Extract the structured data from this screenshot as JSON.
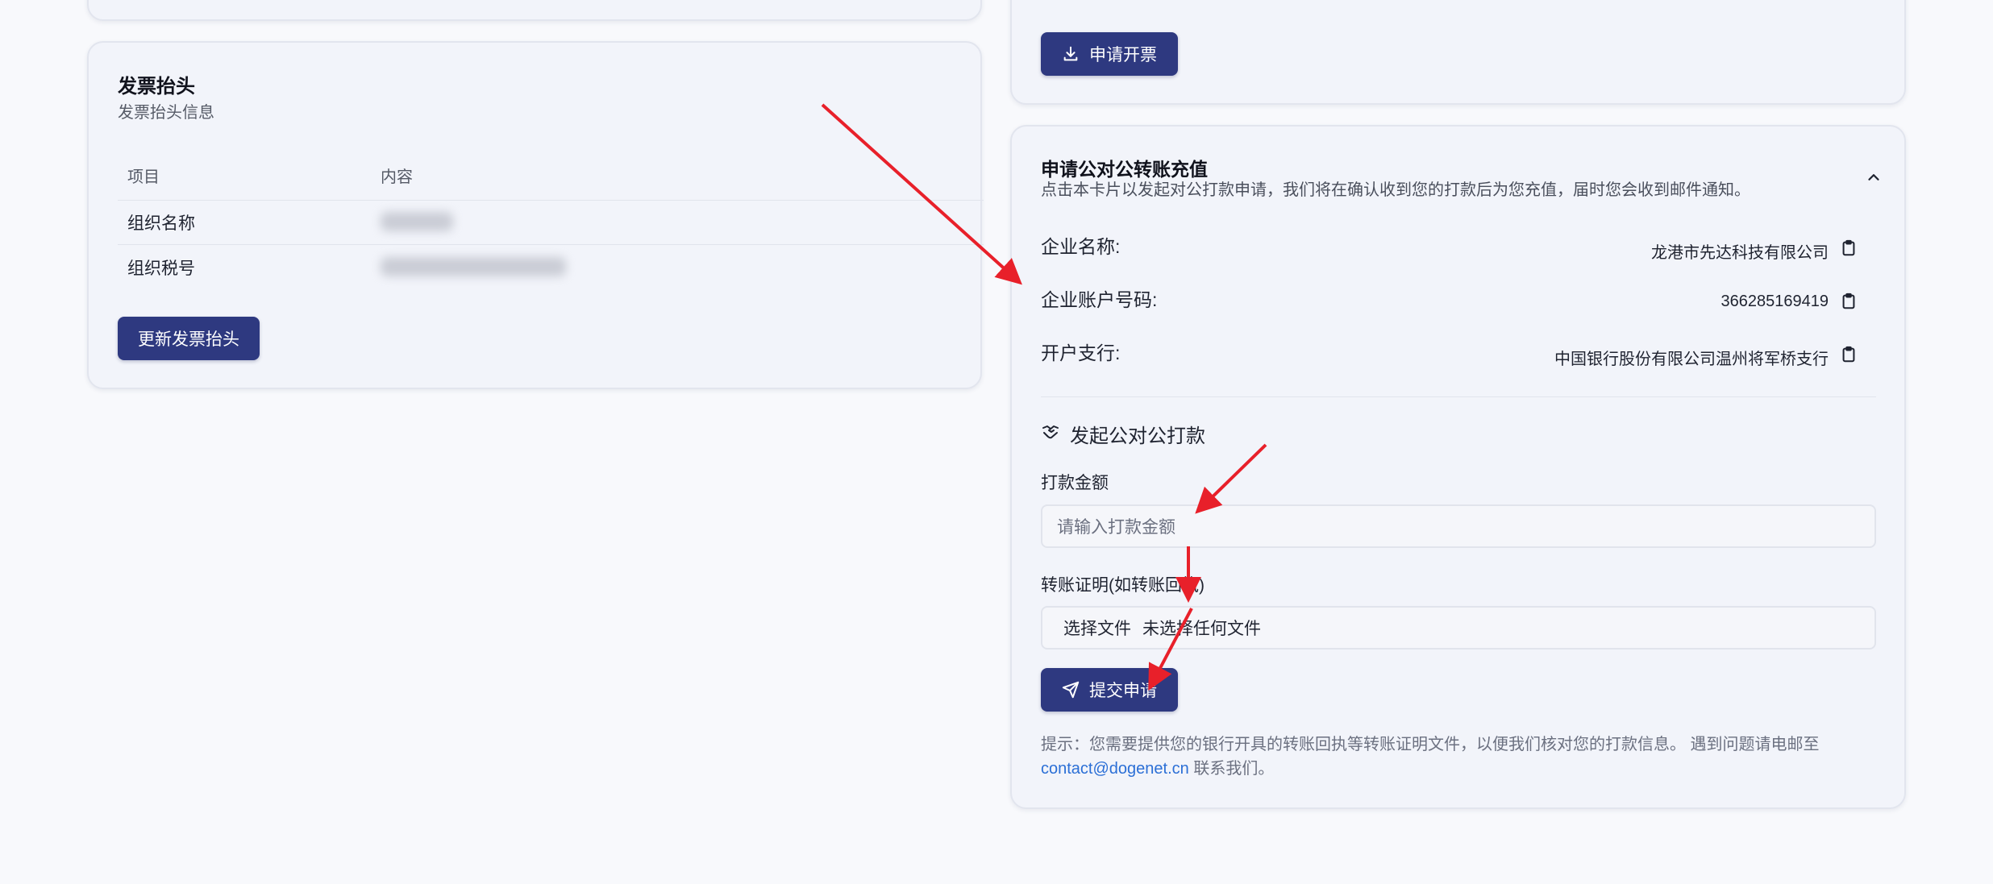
{
  "invoice_header": {
    "title": "发票抬头",
    "subtitle": "发票抬头信息",
    "table": {
      "headers": [
        "项目",
        "内容"
      ],
      "rows": [
        {
          "item": "组织名称",
          "content": ""
        },
        {
          "item": "组织税号",
          "content": ""
        }
      ]
    },
    "update_button": "更新发票抬头"
  },
  "invoice_request": {
    "apply_button": "申请开票"
  },
  "transfer": {
    "title": "申请公对公转账充值",
    "description": "点击本卡片以发起对公打款申请，我们将在确认收到您的打款后为您充值，届时您会收到邮件通知。",
    "fields": [
      {
        "label": "企业名称:",
        "value": "龙港市先达科技有限公司"
      },
      {
        "label": "企业账户号码:",
        "value": "366285169419"
      },
      {
        "label": "开户支行:",
        "value": "中国银行股份有限公司温州将军桥支行"
      }
    ],
    "section_title": "发起公对公打款",
    "amount_label": "打款金额",
    "amount_placeholder": "请输入打款金额",
    "proof_label": "转账证明(如转账回执)",
    "file_button": "选择文件",
    "file_status": "未选择任何文件",
    "submit_button": "提交申请",
    "hint_text": "提示：您需要提供您的银行开具的转账回执等转账证明文件，以便我们核对您的打款信息。 遇到问题请电邮至",
    "hint_email": "contact@dogenet.cn",
    "hint_suffix": " 联系我们。"
  },
  "colors": {
    "primary_button": "#2e3980",
    "annotation_arrow": "#e8202a",
    "link": "#2b6fd6"
  }
}
